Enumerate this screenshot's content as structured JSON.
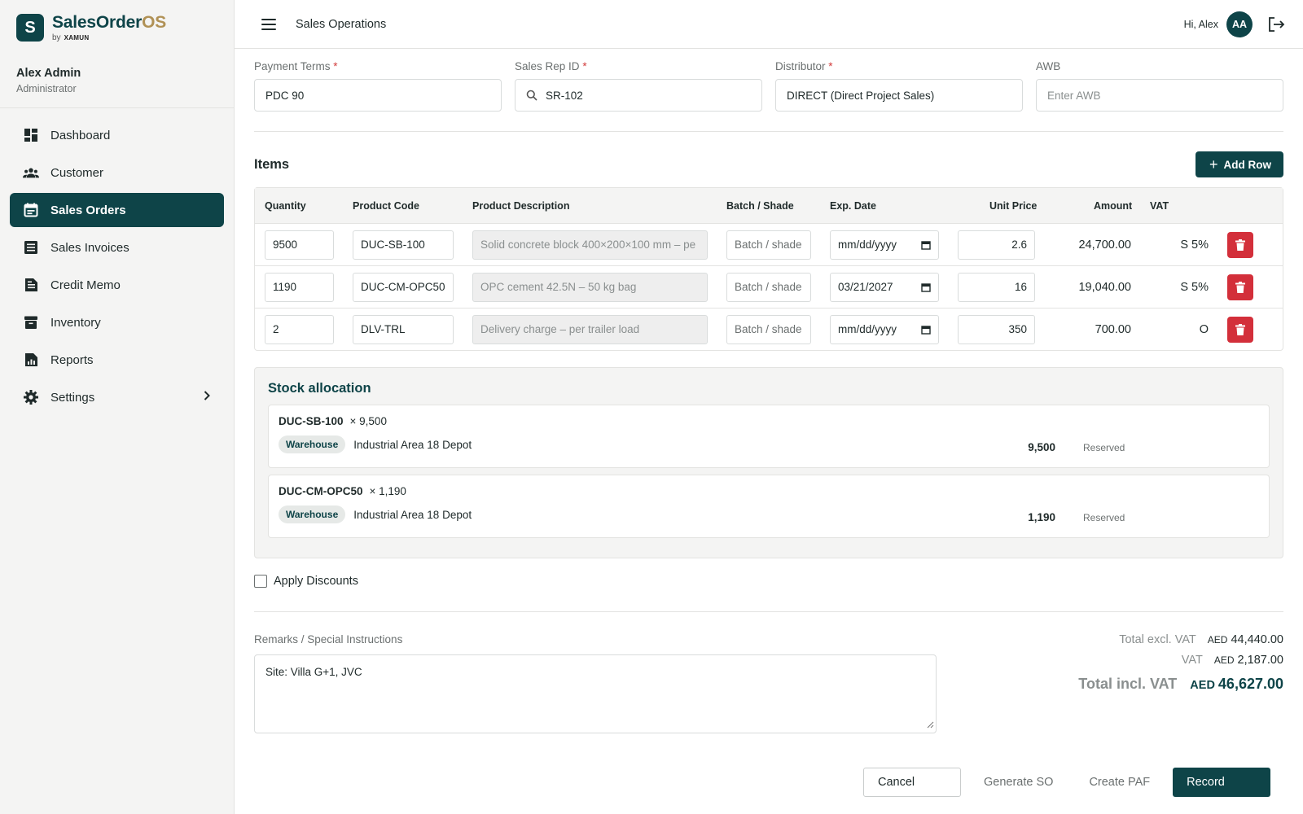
{
  "brand": {
    "logo_letter": "S",
    "name_main": "SalesOrder",
    "name_accent": "OS",
    "by": "by",
    "maker": "XAMUN"
  },
  "user": {
    "name": "Alex Admin",
    "role": "Administrator"
  },
  "sidebar": {
    "items": [
      {
        "label": "Dashboard",
        "icon": "dashboard-icon"
      },
      {
        "label": "Customer",
        "icon": "customer-icon"
      },
      {
        "label": "Sales Orders",
        "icon": "calendar-icon",
        "active": true
      },
      {
        "label": "Sales Invoices",
        "icon": "invoice-icon"
      },
      {
        "label": "Credit Memo",
        "icon": "memo-icon"
      },
      {
        "label": "Inventory",
        "icon": "archive-icon"
      },
      {
        "label": "Reports",
        "icon": "reports-icon"
      },
      {
        "label": "Settings",
        "icon": "gear-icon"
      }
    ]
  },
  "header": {
    "title": "Sales Operations",
    "greeting": "Hi, Alex",
    "avatar_initials": "AA"
  },
  "form": {
    "payment_terms": {
      "label": "Payment Terms",
      "value": "PDC 90"
    },
    "sales_rep": {
      "label": "Sales Rep ID",
      "value": "SR-102"
    },
    "distributor": {
      "label": "Distributor",
      "value": "DIRECT (Direct Project Sales)"
    },
    "awb": {
      "label": "AWB",
      "placeholder": "Enter AWB"
    },
    "required_mark": "*"
  },
  "items": {
    "title": "Items",
    "add_row_label": "Add Row",
    "columns": [
      "Quantity",
      "Product Code",
      "Product Description",
      "Batch / Shade",
      "Exp. Date",
      "Unit Price",
      "Amount",
      "VAT"
    ],
    "rows": [
      {
        "quantity": "9500",
        "code": "DUC-SB-100",
        "description": "Solid concrete block 400×200×100 mm – pe",
        "batch_placeholder": "Batch / shade",
        "exp_date": "mm/dd/yyyy",
        "unit_price": "2.6",
        "amount": "24,700.00",
        "vat": "S 5%"
      },
      {
        "quantity": "1190",
        "code": "DUC-CM-OPC50",
        "description": "OPC cement 42.5N – 50 kg bag",
        "batch_placeholder": "Batch / shade",
        "exp_date": "03/21/2027",
        "unit_price": "16",
        "amount": "19,040.00",
        "vat": "S 5%"
      },
      {
        "quantity": "2",
        "code": "DLV-TRL",
        "description": "Delivery charge – per trailer load",
        "batch_placeholder": "Batch / shade",
        "exp_date": "mm/dd/yyyy",
        "unit_price": "350",
        "amount": "700.00",
        "vat": "O"
      }
    ]
  },
  "stock": {
    "title": "Stock allocation",
    "allocations": [
      {
        "code": "DUC-SB-100",
        "qty_label": "× 9,500",
        "badge": "Warehouse",
        "location": "Industrial Area 18 Depot",
        "qty": "9,500",
        "status": "Reserved"
      },
      {
        "code": "DUC-CM-OPC50",
        "qty_label": "× 1,190",
        "badge": "Warehouse",
        "location": "Industrial Area 18 Depot",
        "qty": "1,190",
        "status": "Reserved"
      }
    ]
  },
  "discount": {
    "label": "Apply Discounts",
    "checked": false
  },
  "remarks": {
    "label": "Remarks / Special Instructions",
    "value": "Site: Villa G+1, JVC"
  },
  "totals": {
    "currency": "AED",
    "excl_label": "Total excl. VAT",
    "excl_value": "44,440.00",
    "vat_label": "VAT",
    "vat_value": "2,187.00",
    "incl_label": "Total incl. VAT",
    "incl_value": "46,627.00"
  },
  "actions": {
    "cancel": "Cancel",
    "generate_so": "Generate SO",
    "create_paf": "Create PAF",
    "record": "Record"
  },
  "colors": {
    "brand": "#0e4448",
    "accent": "#b09155",
    "danger": "#d32f3a",
    "required": "#d23b3b"
  }
}
